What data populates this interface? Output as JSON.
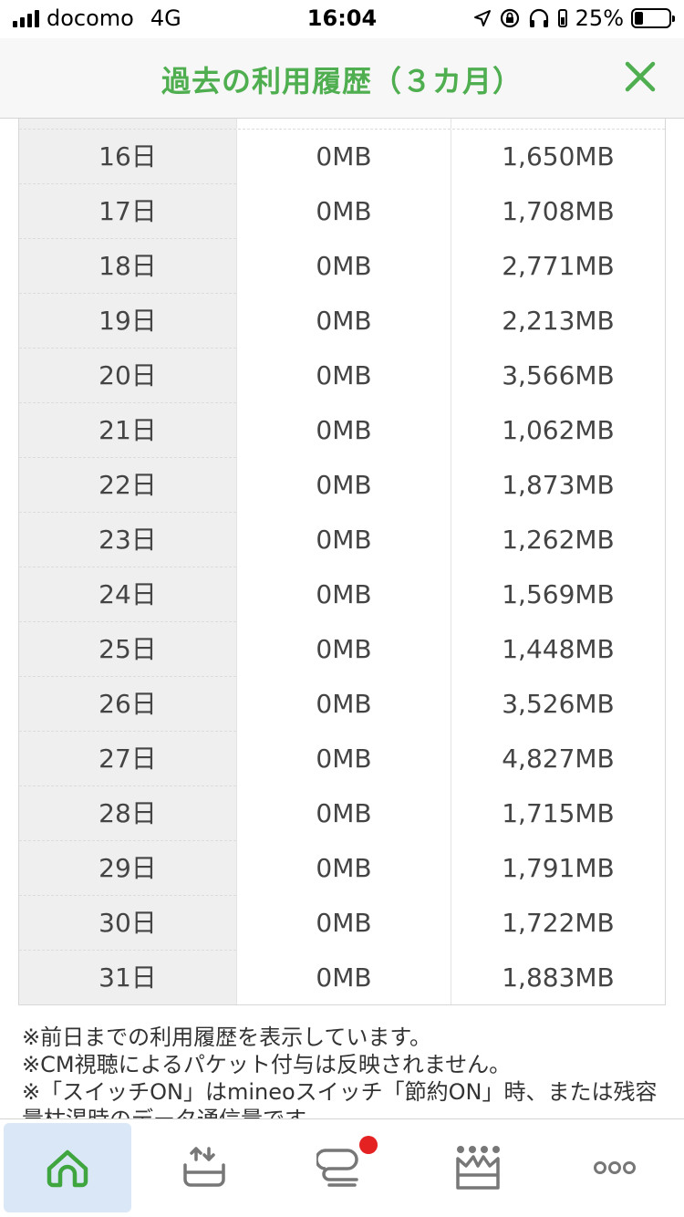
{
  "status_bar": {
    "carrier": "docomo",
    "network": "4G",
    "time": "16:04",
    "battery_percent": "25%",
    "battery_level": 0.25
  },
  "header": {
    "title": "過去の利用履歴（３カ月）",
    "close_icon": "close-icon",
    "accent_color": "#4fae4f"
  },
  "usage_table": {
    "rows": [
      {
        "day": "16日",
        "switch_on": "0MB",
        "usage": "1,650MB"
      },
      {
        "day": "17日",
        "switch_on": "0MB",
        "usage": "1,708MB"
      },
      {
        "day": "18日",
        "switch_on": "0MB",
        "usage": "2,771MB"
      },
      {
        "day": "19日",
        "switch_on": "0MB",
        "usage": "2,213MB"
      },
      {
        "day": "20日",
        "switch_on": "0MB",
        "usage": "3,566MB"
      },
      {
        "day": "21日",
        "switch_on": "0MB",
        "usage": "1,062MB"
      },
      {
        "day": "22日",
        "switch_on": "0MB",
        "usage": "1,873MB"
      },
      {
        "day": "23日",
        "switch_on": "0MB",
        "usage": "1,262MB"
      },
      {
        "day": "24日",
        "switch_on": "0MB",
        "usage": "1,569MB"
      },
      {
        "day": "25日",
        "switch_on": "0MB",
        "usage": "1,448MB"
      },
      {
        "day": "26日",
        "switch_on": "0MB",
        "usage": "3,526MB"
      },
      {
        "day": "27日",
        "switch_on": "0MB",
        "usage": "4,827MB"
      },
      {
        "day": "28日",
        "switch_on": "0MB",
        "usage": "1,715MB"
      },
      {
        "day": "29日",
        "switch_on": "0MB",
        "usage": "1,791MB"
      },
      {
        "day": "30日",
        "switch_on": "0MB",
        "usage": "1,722MB"
      },
      {
        "day": "31日",
        "switch_on": "0MB",
        "usage": "1,883MB"
      }
    ]
  },
  "notes": {
    "line1": "※前日までの利用履歴を表示しています。",
    "line2": "※CM視聴によるパケット付与は反映されません。",
    "line3": "※「スイッチON」はmineoスイッチ「節約ON」時、または残容量枯渇時のデータ通信量です。"
  },
  "bottom_nav": {
    "items": [
      {
        "icon": "home-icon",
        "active": true
      },
      {
        "icon": "upload-tray-icon",
        "active": false
      },
      {
        "icon": "chat-bubble-icon",
        "active": false,
        "badge": true
      },
      {
        "icon": "crown-icon",
        "active": false
      },
      {
        "icon": "more-icon",
        "active": false
      }
    ],
    "badge_color": "#e52222",
    "active_bg": "#d9e7f7"
  }
}
